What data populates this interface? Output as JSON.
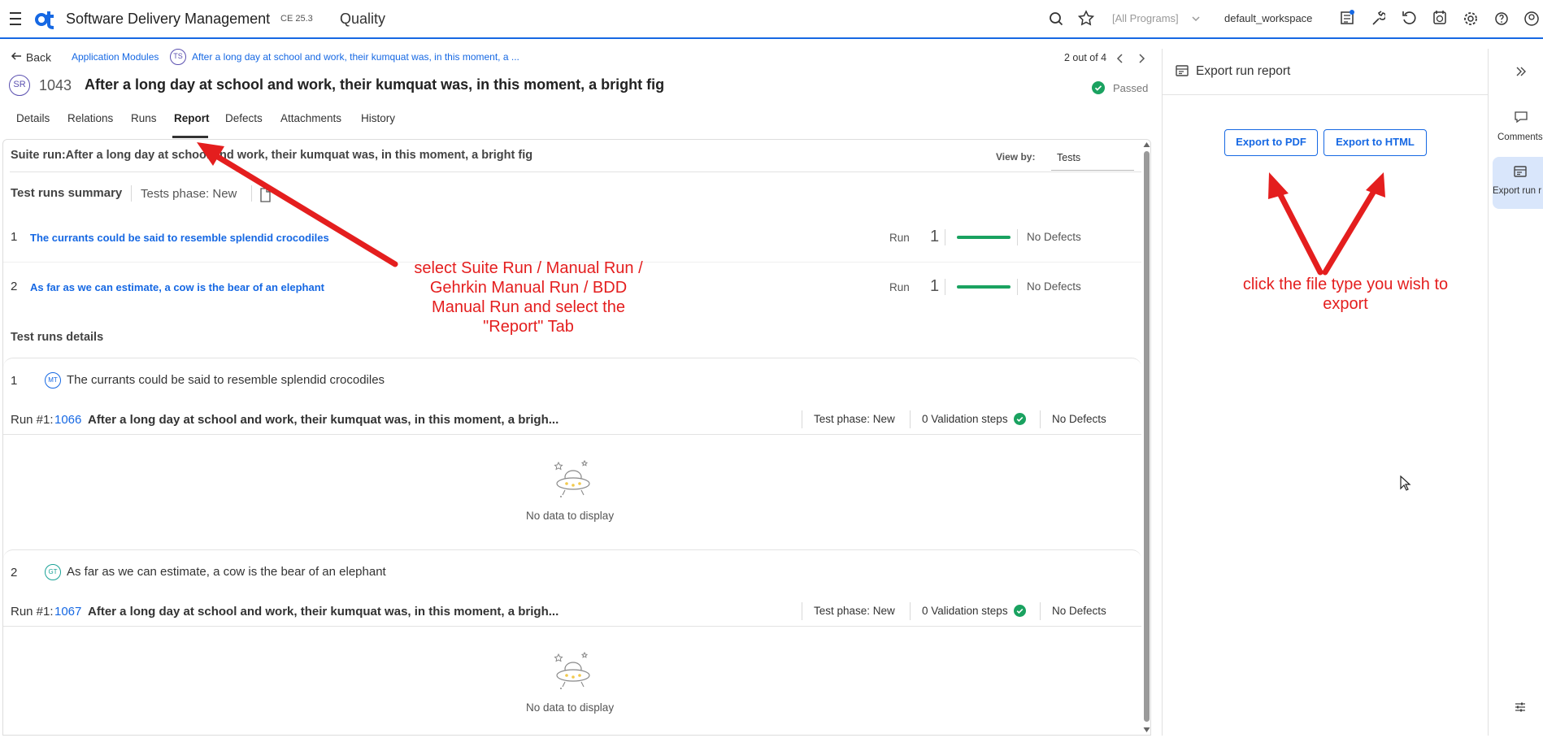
{
  "topbar": {
    "app_title": "Software Delivery Management",
    "version": "CE 25.3",
    "module": "Quality",
    "program_selector": "[All Programs]",
    "workspace": "default_workspace"
  },
  "nav": {
    "back": "Back",
    "breadcrumb_root": "Application Modules",
    "breadcrumb_badge": "TS",
    "breadcrumb_item": "After a long day at school and work, their kumquat was, in this moment, a ...",
    "pager": "2 out of 4"
  },
  "entity": {
    "badge": "SR",
    "id": "1043",
    "title": "After a long day at school and work, their kumquat was, in this moment, a bright fig",
    "status": "Passed"
  },
  "tabs": [
    "Details",
    "Relations",
    "Runs",
    "Report",
    "Defects",
    "Attachments",
    "History"
  ],
  "report": {
    "suite_title": "Suite run:After a long day at school and work, their kumquat was, in this moment, a bright fig",
    "view_by_label": "View by:",
    "view_by_value": "Tests",
    "summary_title": "Test runs summary",
    "summary_phase": "Tests phase: New",
    "summary_rows": [
      {
        "num": "1",
        "name": "The currants could be said to resemble splendid crocodiles",
        "run_label": "Run",
        "run_count": "1",
        "defects": "No Defects"
      },
      {
        "num": "2",
        "name": "As far as we can estimate, a cow is the bear of an elephant",
        "run_label": "Run",
        "run_count": "1",
        "defects": "No Defects"
      }
    ],
    "details_title": "Test runs details",
    "details": [
      {
        "num": "1",
        "badge": "MT",
        "name": "The currants could be said to resemble splendid crocodiles",
        "run_prefix": "Run #1:",
        "run_id": "1066",
        "run_title": "After a long day at school and work, their kumquat was, in this moment, a brigh...",
        "phase": "Test phase: New",
        "steps": "0 Validation steps",
        "defects": "No Defects",
        "empty": "No data to display"
      },
      {
        "num": "2",
        "badge": "GT",
        "name": "As far as we can estimate, a cow is the bear of an elephant",
        "run_prefix": "Run #1:",
        "run_id": "1067",
        "run_title": "After a long day at school and work, their kumquat was, in this moment, a brigh...",
        "phase": "Test phase: New",
        "steps": "0 Validation steps",
        "defects": "No Defects",
        "empty": "No data to display"
      }
    ]
  },
  "export_panel": {
    "title": "Export run report",
    "pdf": "Export to PDF",
    "html": "Export to HTML"
  },
  "right_rail": {
    "comments": "Comments",
    "export": "Export run r"
  },
  "annotations": {
    "left": "select Suite Run / Manual Run / Gehrkin Manual Run / BDD Manual Run and select the \"Report\" Tab",
    "right": "click the file type you wish to export"
  },
  "colors": {
    "accent": "#1668e3",
    "success": "#1aa260",
    "annotation": "#e41e1e"
  }
}
